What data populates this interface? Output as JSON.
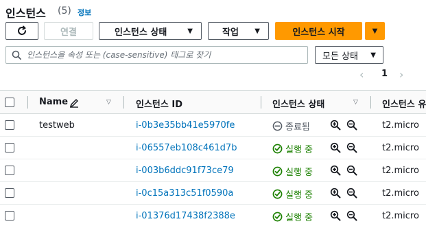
{
  "header": {
    "title": "인스턴스",
    "count": "(5)",
    "info_link": "정보"
  },
  "toolbar": {
    "refresh_icon": "refresh-icon",
    "connect_label": "연결",
    "instance_state_label": "인스턴스 상태",
    "actions_label": "작업",
    "launch_label": "인스턴스 시작"
  },
  "search": {
    "placeholder": "인스턴스을 속성 또는 (case-sensitive) 태그로 찾기"
  },
  "filter": {
    "selected": "모든 상태"
  },
  "pagination": {
    "current_page": "1"
  },
  "table": {
    "columns": [
      "Name",
      "인스턴스 ID",
      "인스턴스 상태",
      "인스턴스 유"
    ],
    "rows": [
      {
        "name": "testweb",
        "instance_id": "i-0b3e35bb41e5970fe",
        "state": "종료됨",
        "state_kind": "stopped",
        "type": "t2.micro"
      },
      {
        "name": "",
        "instance_id": "i-06557eb108c461d7b",
        "state": "실행 중",
        "state_kind": "running",
        "type": "t2.micro"
      },
      {
        "name": "",
        "instance_id": "i-003b6ddc91f73ce79",
        "state": "실행 중",
        "state_kind": "running",
        "type": "t2.micro"
      },
      {
        "name": "",
        "instance_id": "i-0c15a313c51f0590a",
        "state": "실행 중",
        "state_kind": "running",
        "type": "t2.micro"
      },
      {
        "name": "",
        "instance_id": "i-01376d17438f2388e",
        "state": "실행 중",
        "state_kind": "running",
        "type": "t2.micro"
      }
    ]
  },
  "colors": {
    "primary": "#ff9900",
    "link": "#0073bb",
    "running": "#1d8102",
    "stopped": "#545b64"
  }
}
